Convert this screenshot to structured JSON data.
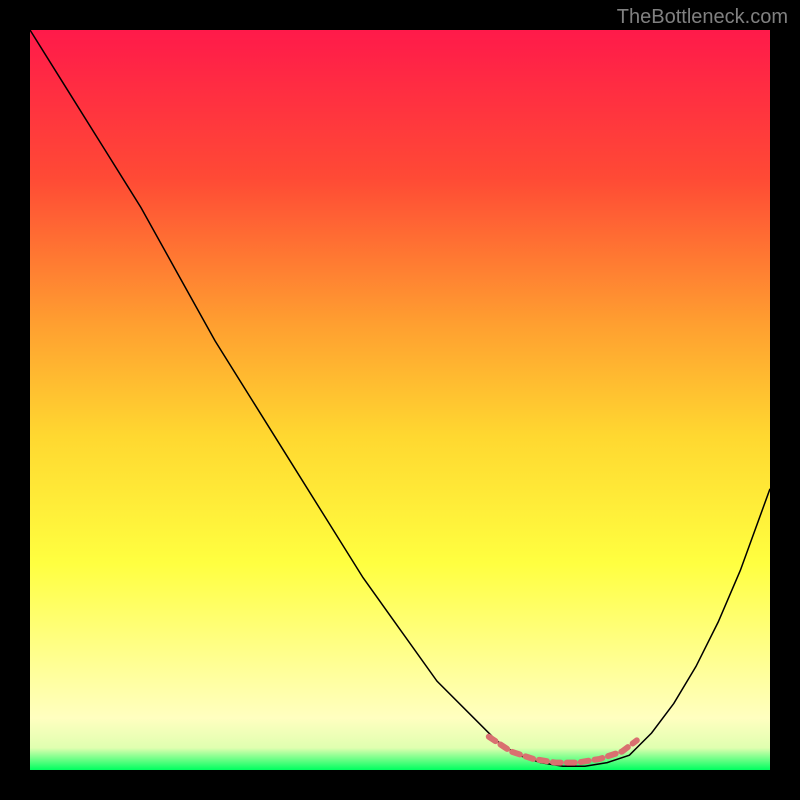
{
  "watermark": "TheBottleneck.com",
  "chart_data": {
    "type": "line",
    "title": "",
    "xlabel": "",
    "ylabel": "",
    "xlim": [
      0,
      100
    ],
    "ylim": [
      0,
      100
    ],
    "background_gradient": {
      "stops": [
        {
          "offset": 0,
          "color": "#ff1a4a"
        },
        {
          "offset": 20,
          "color": "#ff4a35"
        },
        {
          "offset": 40,
          "color": "#ffa030"
        },
        {
          "offset": 55,
          "color": "#ffd830"
        },
        {
          "offset": 72,
          "color": "#ffff40"
        },
        {
          "offset": 85,
          "color": "#ffff90"
        },
        {
          "offset": 93,
          "color": "#ffffc0"
        },
        {
          "offset": 97,
          "color": "#e0ffb0"
        },
        {
          "offset": 100,
          "color": "#00ff60"
        }
      ]
    },
    "series": [
      {
        "name": "bottleneck-curve",
        "color": "#000000",
        "width": 1.5,
        "x": [
          0,
          5,
          10,
          15,
          20,
          25,
          30,
          35,
          40,
          45,
          50,
          55,
          60,
          63,
          66,
          69,
          72,
          75,
          78,
          81,
          84,
          87,
          90,
          93,
          96,
          100
        ],
        "y": [
          100,
          92,
          84,
          76,
          67,
          58,
          50,
          42,
          34,
          26,
          19,
          12,
          7,
          4,
          2,
          1,
          0.5,
          0.5,
          1,
          2,
          5,
          9,
          14,
          20,
          27,
          38
        ]
      },
      {
        "name": "marker-band",
        "color": "#d97070",
        "width": 6,
        "x": [
          62,
          65,
          68,
          71,
          74,
          77,
          80,
          82
        ],
        "y": [
          4.5,
          2.5,
          1.5,
          1,
          1,
          1.5,
          2.5,
          4
        ]
      }
    ]
  }
}
